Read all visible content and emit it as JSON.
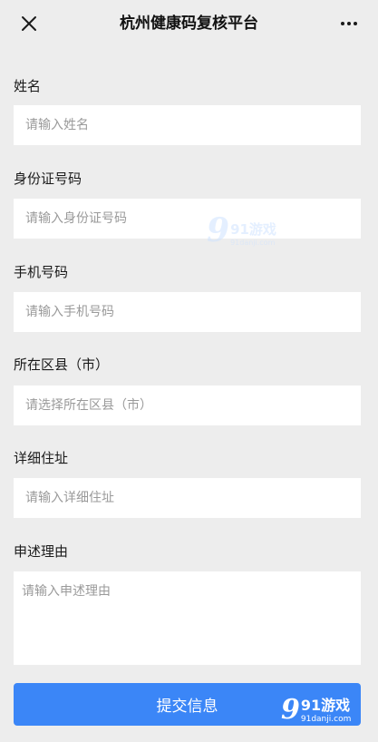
{
  "header": {
    "title": "杭州健康码复核平台",
    "close_icon": "close-icon",
    "more_icon": "more-icon"
  },
  "form": {
    "name": {
      "label": "姓名",
      "placeholder": "请输入姓名"
    },
    "id_number": {
      "label": "身份证号码",
      "placeholder": "请输入身份证号码"
    },
    "phone": {
      "label": "手机号码",
      "placeholder": "请输入手机号码"
    },
    "district": {
      "label": "所在区县（市）",
      "placeholder": "请选择所在区县（市）"
    },
    "address": {
      "label": "详细住址",
      "placeholder": "请输入详细住址"
    },
    "reason": {
      "label": "申述理由",
      "placeholder": "请输入申述理由"
    },
    "submit_label": "提交信息"
  },
  "watermark": {
    "logo_text": "91游戏",
    "url": "91danji.com"
  },
  "colors": {
    "background": "#ededed",
    "field_bg": "#ffffff",
    "primary": "#3b86f7"
  }
}
